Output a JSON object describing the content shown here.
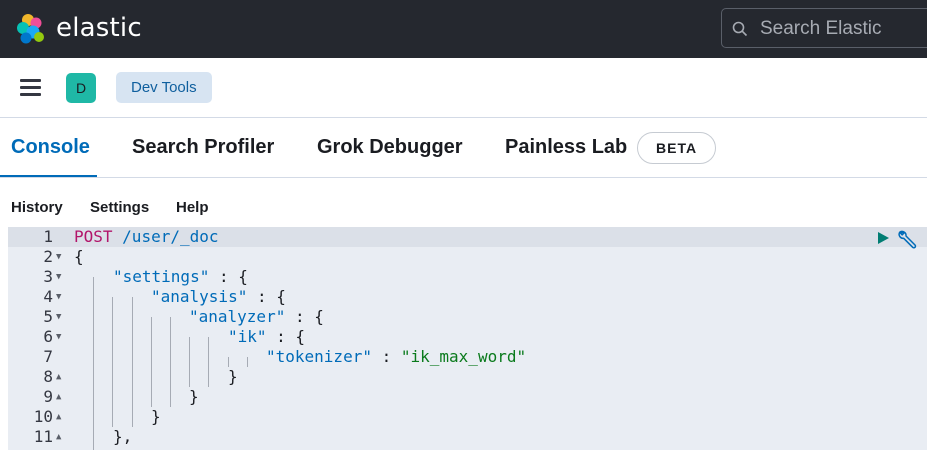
{
  "header": {
    "brand": "elastic",
    "search_placeholder": "Search Elastic"
  },
  "subbar": {
    "avatar_letter": "D",
    "breadcrumb": "Dev Tools"
  },
  "tabs": [
    {
      "label": "Console",
      "active": true
    },
    {
      "label": "Search Profiler",
      "active": false
    },
    {
      "label": "Grok Debugger",
      "active": false
    },
    {
      "label": "Painless Lab",
      "active": false
    }
  ],
  "beta_badge": "BETA",
  "console_menu": [
    "History",
    "Settings",
    "Help"
  ],
  "editor": {
    "line_numbers": [
      "1",
      "2",
      "3",
      "4",
      "5",
      "6",
      "7",
      "8",
      "9",
      "10",
      "11"
    ],
    "request": {
      "method": "POST",
      "path": "/user/_doc"
    },
    "lines": {
      "l2": "{",
      "l3_key": "\"settings\"",
      "l4_key": "\"analysis\"",
      "l5_key": "\"analyzer\"",
      "l6_key": "\"ik\"",
      "l7_key": "\"tokenizer\"",
      "l7_value": "\"ik_max_word\"",
      "colon_open": " : {",
      "colon": " : ",
      "close_brace": "}",
      "close_brace_comma": "},"
    }
  },
  "colors": {
    "accent": "#006bb8",
    "header_bg": "#25282f",
    "editor_bg": "#e9edf3",
    "method_color": "#b2156a",
    "string_value_color": "#0a7a1c",
    "run_icon": "#017d73"
  },
  "icons": [
    "elastic-logo-icon",
    "search-icon",
    "hamburger-menu-icon",
    "run-request-icon",
    "wrench-icon",
    "fold-down-icon",
    "fold-up-icon"
  ]
}
